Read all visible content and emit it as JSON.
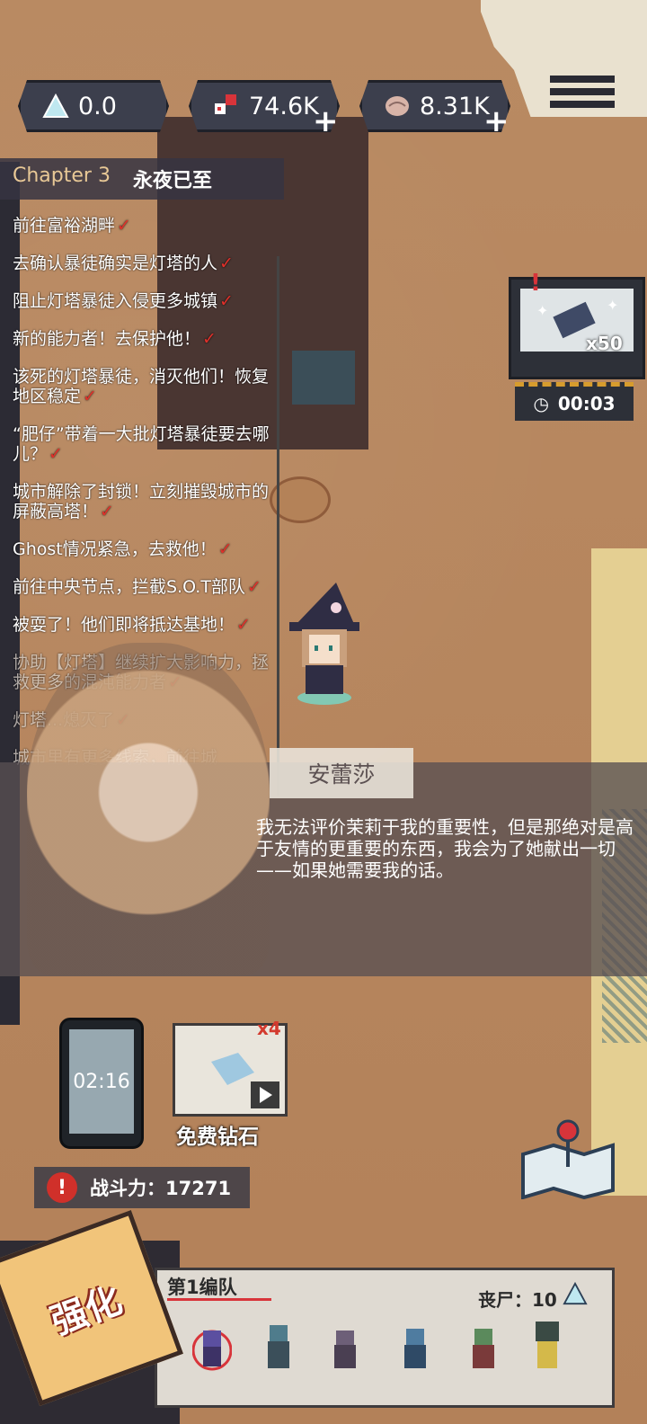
{
  "currencies": [
    {
      "icon": "triangle-crystal-icon",
      "value": "0.0",
      "plus": false
    },
    {
      "icon": "dice-icon",
      "value": "74.6K",
      "plus": true
    },
    {
      "icon": "brain-icon",
      "value": "8.31K",
      "plus": true
    }
  ],
  "quest_log": {
    "chapter": "Chapter 3",
    "chapter_title": "永夜已至",
    "items": [
      {
        "text": "前往富裕湖畔",
        "done": true
      },
      {
        "text": "去确认暴徒确实是灯塔的人",
        "done": true
      },
      {
        "text": "阻止灯塔暴徒入侵更多城镇",
        "done": true
      },
      {
        "text": "新的能力者！去保护他！",
        "done": true
      },
      {
        "text": "该死的灯塔暴徒，消灭他们！恢复地区稳定",
        "done": true
      },
      {
        "text": "“肥仔”带着一大批灯塔暴徒要去哪儿？",
        "done": true
      },
      {
        "text": "城市解除了封锁！立刻摧毁城市的屏蔽高塔！",
        "done": true
      },
      {
        "text": "Ghost情况紧急，去救他！",
        "done": true
      },
      {
        "text": "前往中央节点，拦截S.O.T部队",
        "done": true
      },
      {
        "text": "被耍了！他们即将抵达基地！",
        "done": true
      },
      {
        "text": "协助【灯塔】继续扩大影响力，拯救更多的混沌能力者",
        "done": true
      },
      {
        "text": "灯塔...熄灭了",
        "done": true
      },
      {
        "text": "城市里有更多线索，前往城",
        "done": false
      }
    ]
  },
  "dialog": {
    "speaker": "安蕾莎",
    "text": "我无法评价茉莉于我的重要性，但是那绝对是高于友情的更重要的东西，我会为了她献出一切——如果她需要我的话。"
  },
  "chest_reward": {
    "count": "x50",
    "timer": "00:03"
  },
  "phone_timer": "02:16",
  "free_diamond": {
    "label": "免费钻石",
    "multiplier": "x4"
  },
  "combat_power": {
    "label": "战斗力：17271"
  },
  "team": {
    "name": "第1编队",
    "zombie_count": "丧尸：10"
  },
  "enhance_label": "强化",
  "colors": {
    "hud_bg": "#3c3f4d",
    "accent_red": "#d8343a",
    "quest_check": "#e0302a",
    "chapter_gold": "#e8c896"
  }
}
